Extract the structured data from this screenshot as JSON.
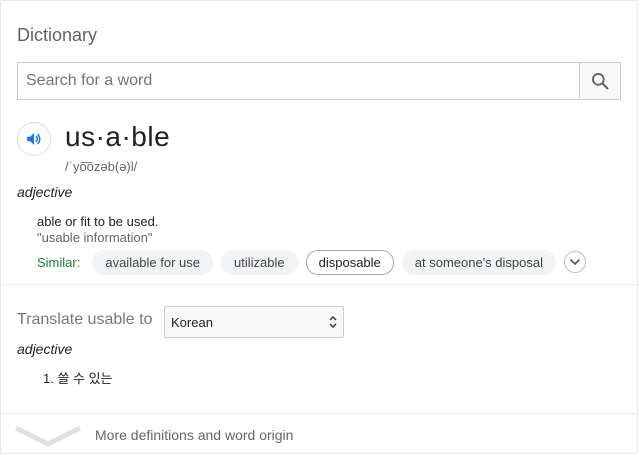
{
  "header": {
    "title": "Dictionary"
  },
  "search": {
    "placeholder": "Search for a word",
    "value": ""
  },
  "entry": {
    "word": "us·a·ble",
    "phonetic": "/ˈyo͞ozəb(ə)l/",
    "part_of_speech": "adjective",
    "definition": "able or fit to be used.",
    "example": "\"usable information\"",
    "similar_label": "Similar:",
    "similar": [
      "available for use",
      "utilizable",
      "disposable",
      "at someone's disposal"
    ]
  },
  "translate": {
    "label": "Translate usable to",
    "language": "Korean",
    "part_of_speech": "adjective",
    "items": [
      "1. 쓸 수 있는"
    ]
  },
  "footer": {
    "more_label": "More definitions and word origin"
  },
  "colors": {
    "accent": "#1a73e8",
    "similar_green": "#188038"
  }
}
